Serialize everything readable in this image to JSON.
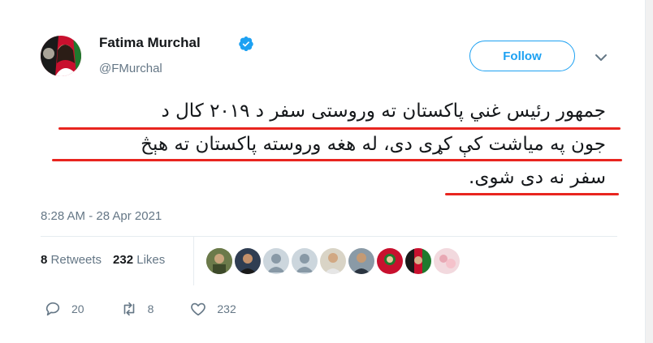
{
  "tweet": {
    "author_name": "Fatima Murchal",
    "handle": "@FMurchal",
    "follow_label": "Follow",
    "text_lines": [
      "جمهور رئیس غني پاکستان ته وروستی سفر د ۲۰۱۹ کال د",
      "جون په میاشت کې کړی دی، له هغه وروسته پاکستان ته هېڅ",
      "سفر نه دی شوی."
    ],
    "timestamp": "8:28 AM - 28 Apr 2021"
  },
  "stats": {
    "retweets_count": "8",
    "retweets_label": "Retweets",
    "likes_count": "232",
    "likes_label": "Likes"
  },
  "actions": {
    "reply_count": "20",
    "retweet_count": "8",
    "like_count": "232"
  },
  "colors": {
    "accent": "#1da1f2",
    "highlight_underline": "#e8251f",
    "muted_text": "#657786"
  }
}
